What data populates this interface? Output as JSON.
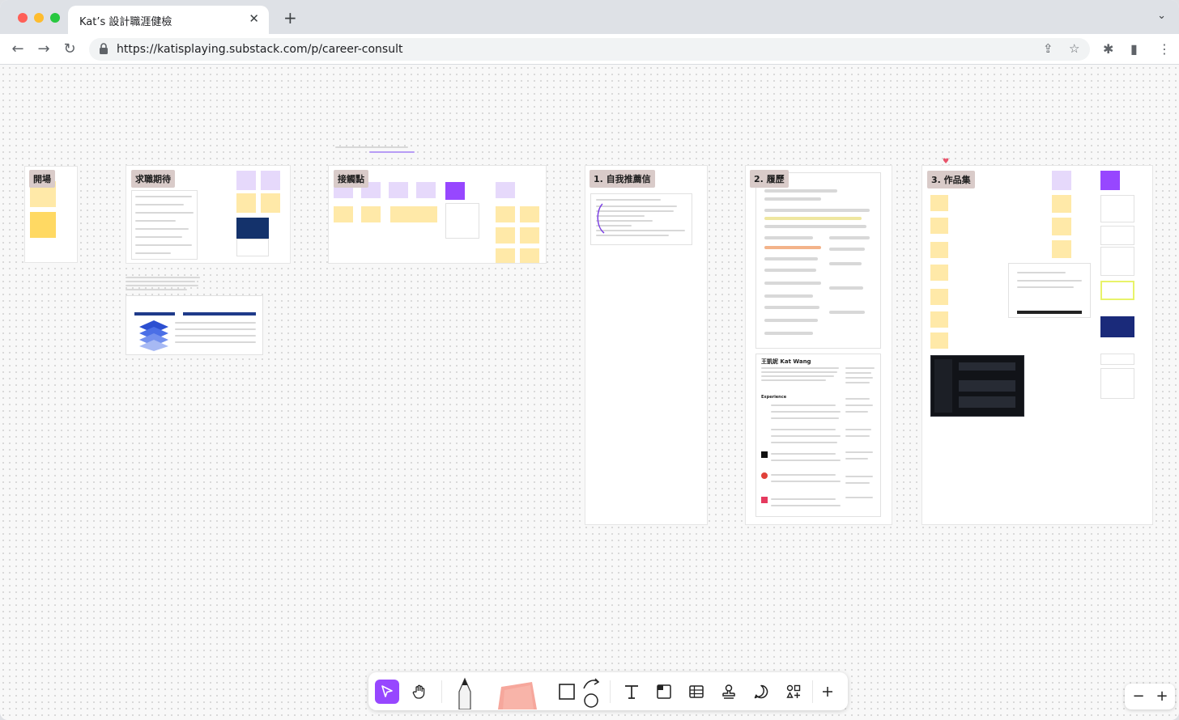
{
  "browser": {
    "tab_title": "Kat’s 設計職涯健檢",
    "url": "https://katisplaying.substack.com/p/career-consult"
  },
  "board": {
    "sections": [
      {
        "label": "開場"
      },
      {
        "label": "求職期待"
      },
      {
        "label": "接觸點"
      },
      {
        "label": "1. 自我推薦信"
      },
      {
        "label": "2. 履歷"
      },
      {
        "label": "3. 作品集"
      }
    ],
    "resume_name": "王凱妮 Kat Wang",
    "resume_experience": "Experience",
    "toolbar_tools": [
      "move",
      "hand",
      "pen",
      "sticky",
      "shape",
      "text",
      "section",
      "table",
      "stamp",
      "comment",
      "widgets",
      "more"
    ],
    "zoom": {
      "out": "−",
      "in": "+"
    }
  },
  "colors": {
    "accent": "#9747ff",
    "sticky_yellow": "#ffe9a8",
    "sticky_purple": "#e6d9fb",
    "section_label": "#d9cbc9"
  }
}
